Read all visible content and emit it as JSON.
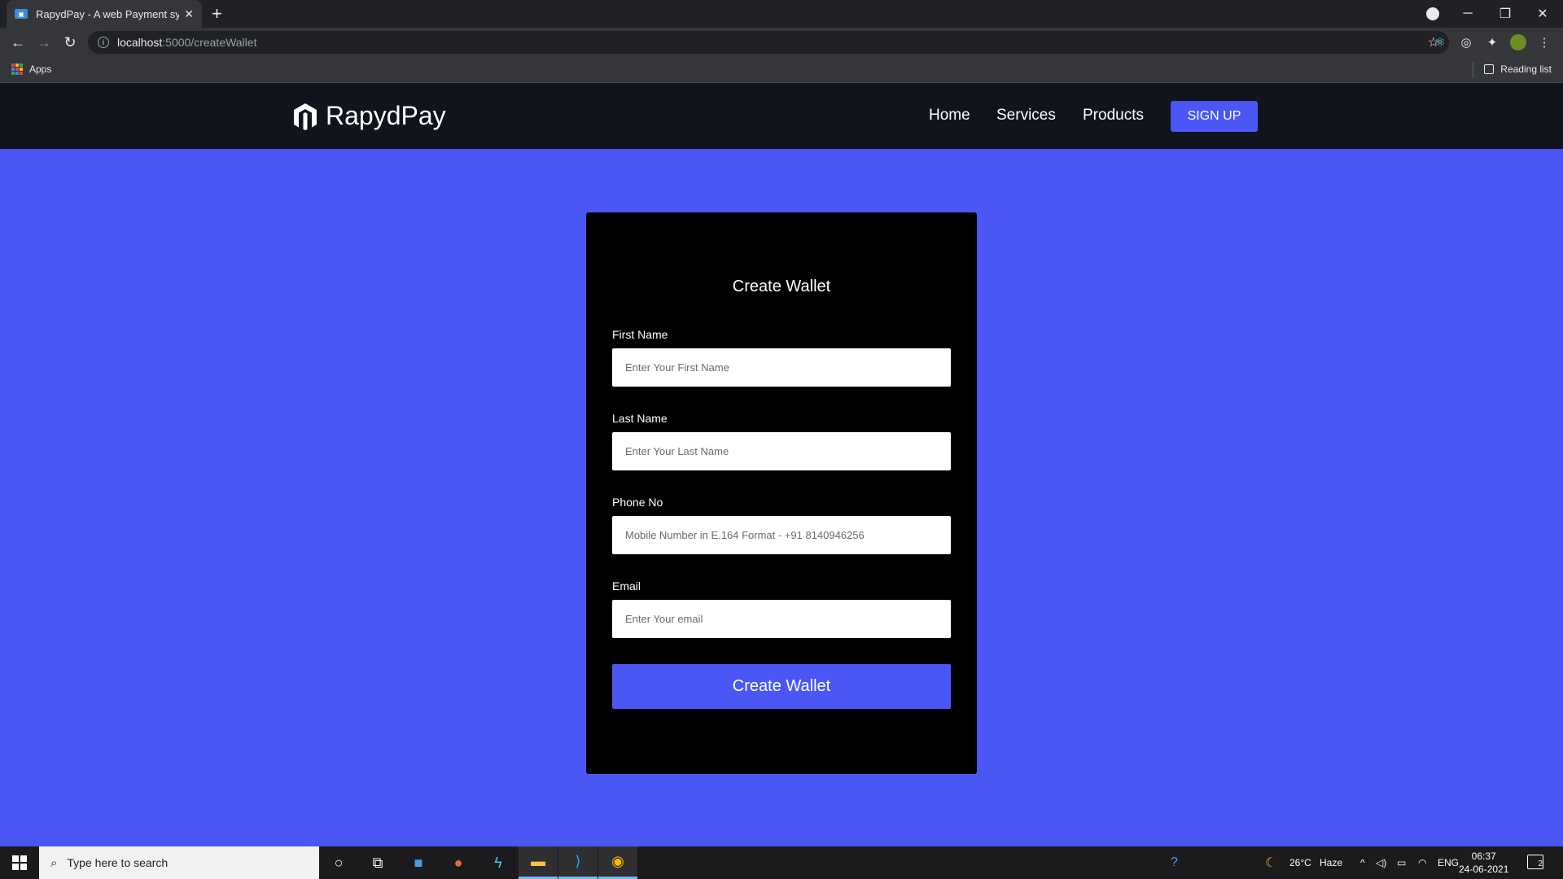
{
  "browser": {
    "tab_title": "RapydPay - A web Payment syste",
    "tab_close": "✕",
    "new_tab": "+",
    "url_host": "localhost",
    "url_path": ":5000/createWallet",
    "bookmarks": {
      "apps_label": "Apps",
      "reading_list_label": "Reading list"
    },
    "window_controls": {
      "minimize": "─",
      "restore": "❐",
      "close": "✕"
    }
  },
  "site": {
    "brand": "RapydPay",
    "nav": {
      "home": "Home",
      "services": "Services",
      "products": "Products"
    },
    "signup_label": "SIGN UP",
    "colors": {
      "primary": "#4b57f4",
      "header_bg": "#11141c",
      "card_bg": "#000000"
    }
  },
  "form": {
    "title": "Create Wallet",
    "first_name": {
      "label": "First Name",
      "placeholder": "Enter Your First Name"
    },
    "last_name": {
      "label": "Last Name",
      "placeholder": "Enter Your Last Name"
    },
    "phone": {
      "label": "Phone No",
      "placeholder": "Mobile Number in E.164 Format - +91 8140946256"
    },
    "email": {
      "label": "Email",
      "placeholder": "Enter Your email"
    },
    "submit_label": "Create Wallet"
  },
  "taskbar": {
    "search_placeholder": "Type here to search",
    "weather_temp": "26°C",
    "weather_text": "Haze",
    "language": "ENG",
    "time": "06:37",
    "date": "24-06-2021",
    "notification_count": "2"
  }
}
